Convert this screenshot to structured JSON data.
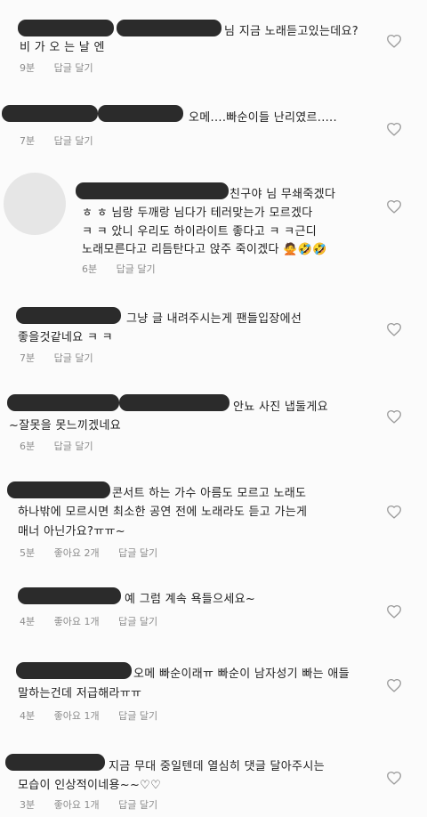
{
  "comments": [
    {
      "lines": [
        "님 지금 노래듣고있는데요?",
        "비 가 오 는 날 엔"
      ],
      "time": "9분",
      "likes": "",
      "reply": "답글 달기"
    },
    {
      "lines": [
        "오메....빠순이들 난리였르....."
      ],
      "time": "7분",
      "likes": "",
      "reply": "답글 달기"
    },
    {
      "lines": [
        "친구야 님 무쇄죽겠다",
        "ㅎ ㅎ 님랑 두깨랑 님다가 테러맞는가 모르겠다",
        "ㅋ ㅋ 았니 우리도 하이라이트 좋다고 ㅋ ㅋ근디",
        "노래모른다고 리듬탄다고 앉주 죽이겠다 🙅🤣🤣"
      ],
      "time": "6분",
      "likes": "",
      "reply": "답글 달기"
    },
    {
      "lines": [
        "그냥 글 내려주시는게 팬들입장에선",
        "좋을것같네요 ㅋ ㅋ"
      ],
      "time": "7분",
      "likes": "",
      "reply": "답글 달기"
    },
    {
      "lines": [
        "안뇨 사진 냅둘게요",
        "~잘못을 못느끼겠네요"
      ],
      "time": "6분",
      "likes": "",
      "reply": "답글 달기"
    },
    {
      "lines": [
        "콘서트 하는 가수 아름도 모르고 노래도",
        "하나밖에 모르시면 최소한 공연 전에 노래라도 듣고 가는게",
        "매너 아닌가요?ㅠㅠ~"
      ],
      "time": "5분",
      "likes": "좋아요 2개",
      "reply": "답글 달기"
    },
    {
      "lines": [
        "예 그럼 계속 욕들으세요~"
      ],
      "time": "4분",
      "likes": "좋아요 1개",
      "reply": "답글 달기"
    },
    {
      "lines": [
        "오메 빠순이래ㅠ 빠순이 남자성기 빠는 애들",
        "말하는건데 저급해라ㅠㅠ"
      ],
      "time": "4분",
      "likes": "좋아요 1개",
      "reply": "답글 달기"
    },
    {
      "lines": [
        "지금 무대 중일텐데 열심히 댓글 달아주시는",
        "모습이 인상적이네용~~♡♡"
      ],
      "time": "3분",
      "likes": "좋아요 1개",
      "reply": "답글 달기"
    }
  ],
  "icons": {
    "heart": "heart-outline-icon",
    "avatar": "avatar-placeholder"
  }
}
